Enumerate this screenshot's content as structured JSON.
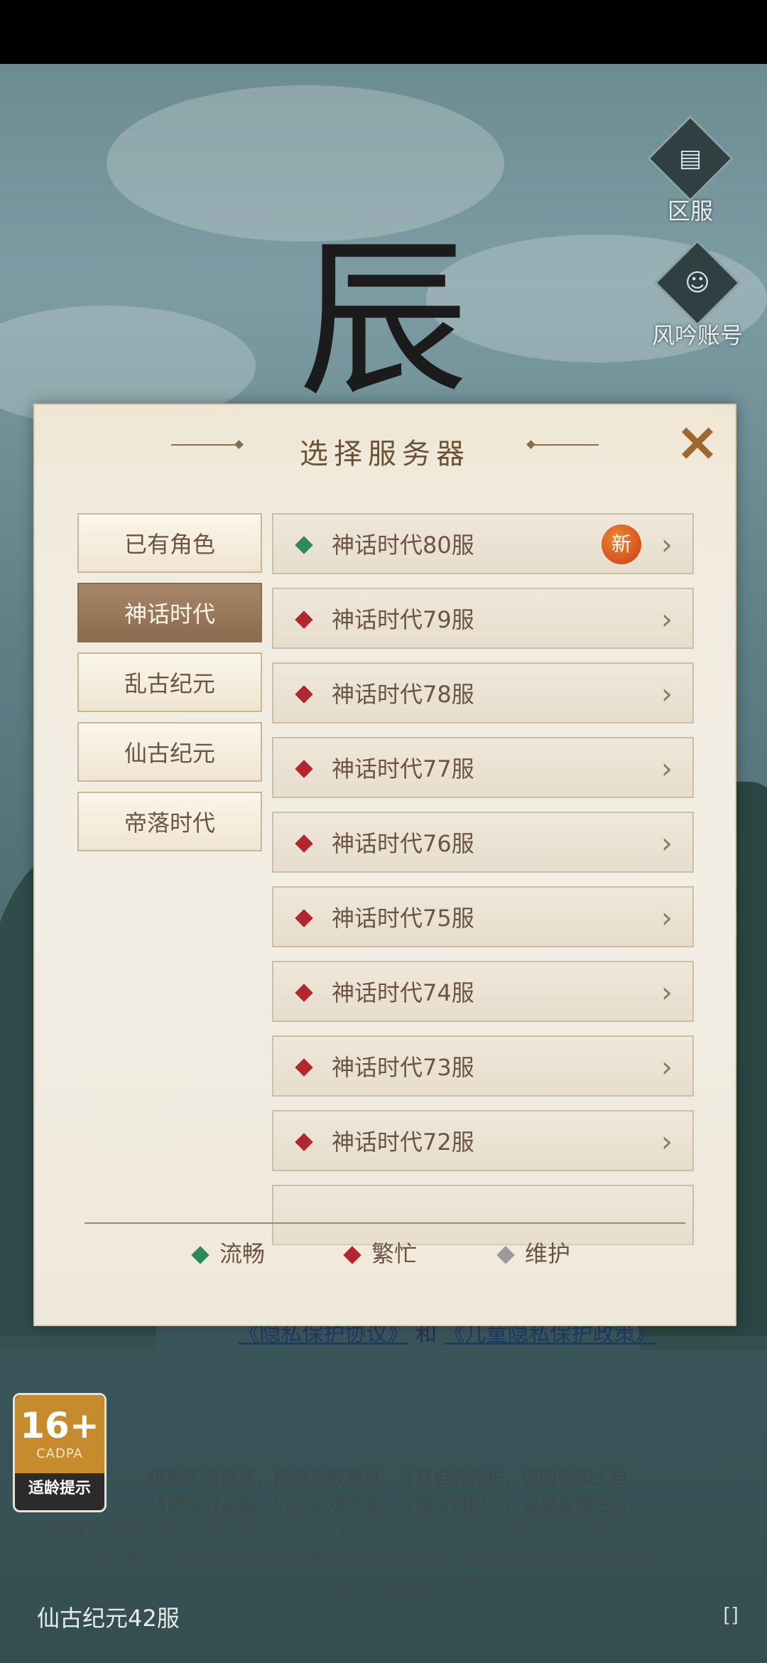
{
  "dialog": {
    "title": "选择服务器",
    "close_icon": "close-x-icon",
    "categories": [
      {
        "label": "已有角色",
        "active": false
      },
      {
        "label": "神话时代",
        "active": true
      },
      {
        "label": "乱古纪元",
        "active": false
      },
      {
        "label": "仙古纪元",
        "active": false
      },
      {
        "label": "帝落时代",
        "active": false
      }
    ],
    "servers": [
      {
        "name": "神话时代80服",
        "status": "smooth",
        "new_badge": "新"
      },
      {
        "name": "神话时代79服",
        "status": "busy"
      },
      {
        "name": "神话时代78服",
        "status": "busy"
      },
      {
        "name": "神话时代77服",
        "status": "busy"
      },
      {
        "name": "神话时代76服",
        "status": "busy"
      },
      {
        "name": "神话时代75服",
        "status": "busy"
      },
      {
        "name": "神话时代74服",
        "status": "busy"
      },
      {
        "name": "神话时代73服",
        "status": "busy"
      },
      {
        "name": "神话时代72服",
        "status": "busy"
      }
    ],
    "chevron_icon": "chevron-right-icon",
    "legend": [
      {
        "label": "流畅",
        "color": "#2e8a5a"
      },
      {
        "label": "繁忙",
        "color": "#b3262d"
      },
      {
        "label": "维护",
        "color": "#9a9a9a"
      }
    ],
    "status_colors": {
      "smooth": "#2e8a5a",
      "busy": "#b3262d",
      "maintenance": "#9a9a9a"
    }
  },
  "side_buttons": {
    "server_label": "区服",
    "account_label": "风吟账号"
  },
  "footer": {
    "privacy_link": "《隐私保护协议》",
    "and_text": "和",
    "child_privacy_link": "《儿童隐私保护政策》",
    "age_rating": "16+",
    "age_org": "CADPA",
    "age_tip": "适龄提示",
    "notice_line1": "抵制不良游戏，拒绝盗版游戏。注意自我保护，谨防受骗上当。",
    "notice_line2": "适度游戏益脑，沉迷游戏伤身。合理安排时间，享受健康生活。",
    "info_line1": "游戏名称：辰东群侠传  审批文号：新广出审【2017】10379号  出版物号：ISBN  978-7-498-03166-2",
    "info_line2": "著作权人：成都星阅辰石文化发展有限公司  出版单位：成都盈众九州网络科技有限公司",
    "info_line3": "运营单位：成都龙游网络科技有限公司",
    "current_server": "仙古纪元42服"
  }
}
